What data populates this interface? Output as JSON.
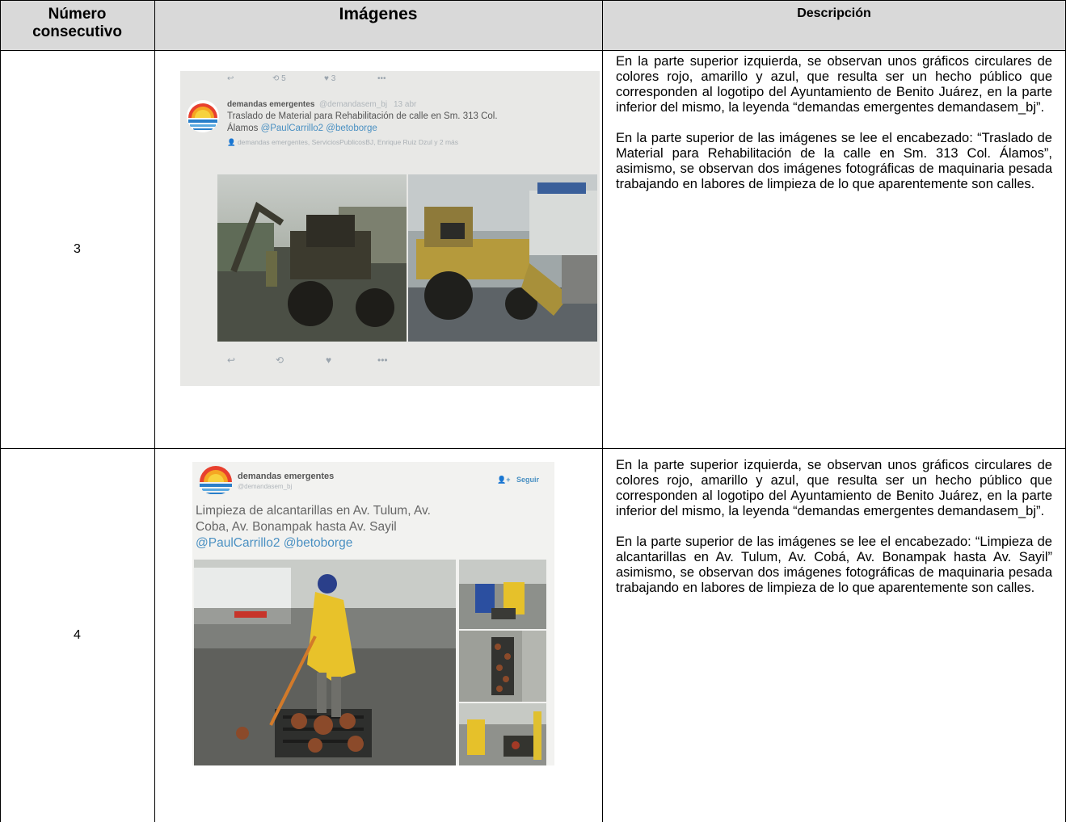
{
  "table": {
    "headers": {
      "number_line1": "Número",
      "number_line2": "consecutivo",
      "images": "Imágenes",
      "description": "Descripción"
    },
    "rows": [
      {
        "number": "3",
        "tweet": {
          "user": "demandas emergentes",
          "handle": "@demandasem_bj",
          "time": "13 abr",
          "text": "Traslado de Material para Rehabilitación de calle en Sm. 313 Col.",
          "text2": "Álamos",
          "mentions": "@PaulCarrillo2 @betoborge",
          "meta": "demandas emergentes, ServiciosPublicosBJ, Enrique Ruiz Dzul y 2 más"
        },
        "description": [
          "En la parte superior izquierda, se observan unos gráficos circulares de colores rojo, amarillo y azul, que resulta ser un hecho público que corresponden al logotipo del Ayuntamiento de Benito Juárez, en la parte inferior del mismo, la leyenda “demandas emergentes demandasem_bj”.",
          "En la parte superior de las imágenes se lee el encabezado: “Traslado de Material para Rehabilitación de la calle en Sm. 313 Col. Álamos”, asimismo, se observan dos imágenes fotográficas de maquinaria pesada trabajando en labores de limpieza de lo que aparentemente son calles."
        ]
      },
      {
        "number": "4",
        "tweet": {
          "user": "demandas emergentes",
          "handle": "@demandasem_bj",
          "follow": "Seguir",
          "text_line1": "Limpieza de alcantarillas en Av. Tulum, Av.",
          "text_line2": "Coba, Av. Bonampak hasta Av. Sayil",
          "mentions": "@PaulCarrillo2 @betoborge"
        },
        "description": [
          "En la parte superior izquierda, se observan unos gráficos circulares de colores rojo, amarillo y azul, que resulta ser un hecho público que corresponden al logotipo del Ayuntamiento de Benito Juárez, en la parte inferior del mismo, la leyenda “demandas emergentes demandasem_bj”.",
          "En la parte superior de las imágenes se lee el encabezado: “Limpieza de alcantarillas en Av. Tulum, Av. Cobá, Av. Bonampak hasta Av. Sayil” asimismo, se observan dos imágenes fotográficas de maquinaria pesada trabajando en labores de limpieza de lo que aparentemente son calles."
        ]
      }
    ]
  },
  "colors": {
    "header_bg": "#d9d9d9",
    "border": "#000000",
    "link": "#4a90c2"
  }
}
